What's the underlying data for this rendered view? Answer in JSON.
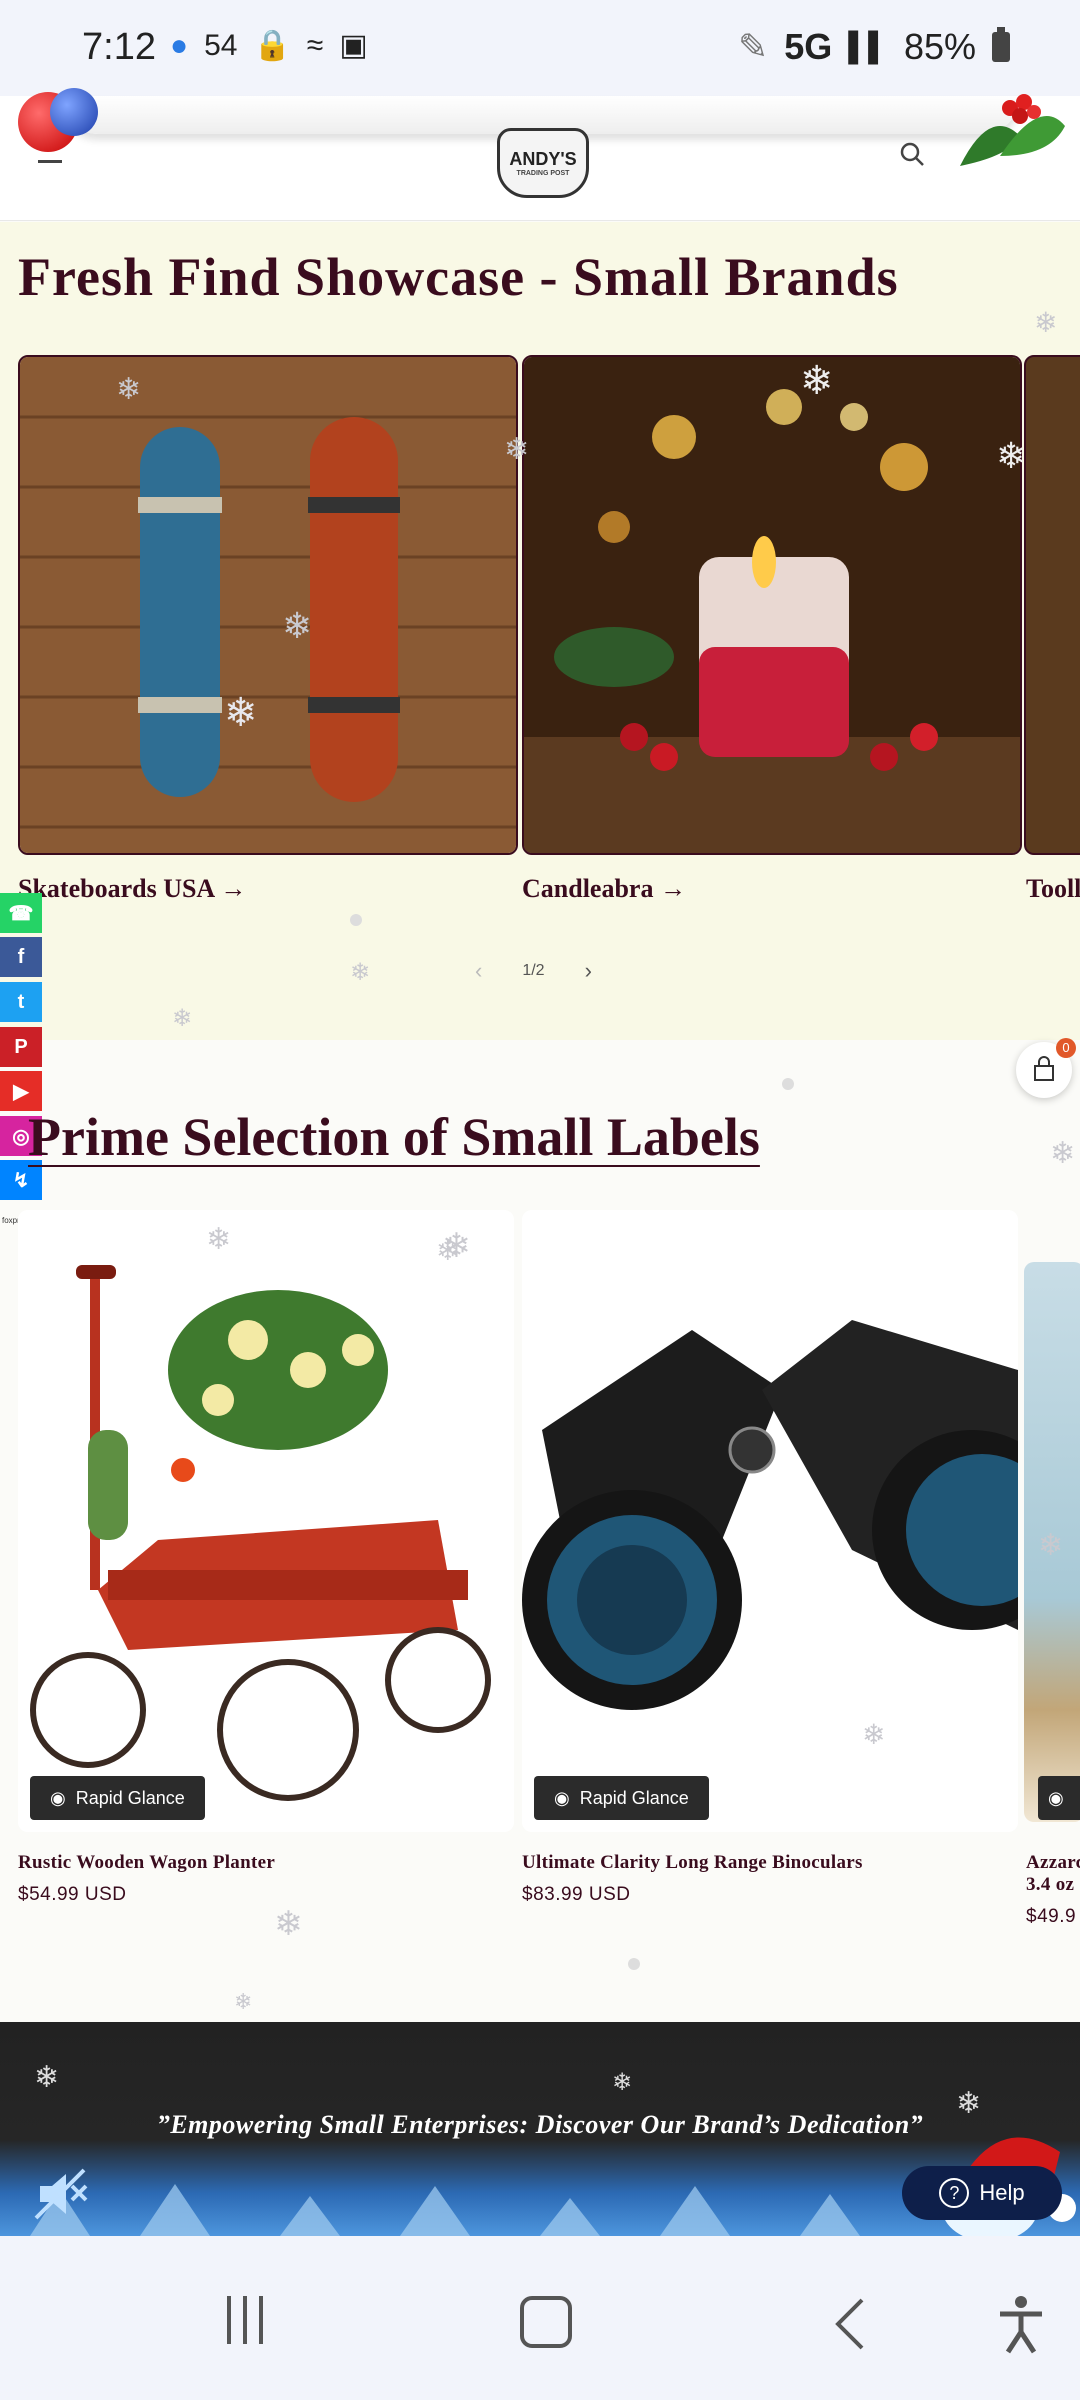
{
  "status_bar": {
    "time": "7:12",
    "mid_icons": "54",
    "network": "5G",
    "battery": "85%"
  },
  "header": {
    "logo_line1": "ANDY'S",
    "logo_line2": "TRADING POST"
  },
  "showcase": {
    "title": "Fresh Find Showcase - Small Brands",
    "cards": [
      {
        "label": "Skateboards USA →"
      },
      {
        "label": "Candleabra →"
      },
      {
        "label": "Tooll"
      }
    ],
    "pager": {
      "prev": "‹",
      "text": "1/2",
      "next": "›"
    }
  },
  "social": [
    {
      "name": "whatsapp",
      "glyph": "☎",
      "color": "#25d366"
    },
    {
      "name": "facebook",
      "glyph": "f",
      "color": "#3b5998"
    },
    {
      "name": "twitter",
      "glyph": "t",
      "color": "#1da1f2"
    },
    {
      "name": "pinterest",
      "glyph": "P",
      "color": "#cb2027"
    },
    {
      "name": "youtube",
      "glyph": "▶",
      "color": "#e52d27"
    },
    {
      "name": "instagram",
      "glyph": "◎",
      "color": "#d6249f"
    },
    {
      "name": "messenger",
      "glyph": "↯",
      "color": "#0084ff"
    }
  ],
  "cart": {
    "count": "0"
  },
  "prime": {
    "title": "Prime Selection of Small Labels",
    "tiny_label": "foxprime",
    "quick_label": "Rapid Glance",
    "products": [
      {
        "title": "Rustic Wooden Wagon Planter",
        "price": "$54.99 USD"
      },
      {
        "title": "Ultimate Clarity Long Range Binoculars",
        "price": "$83.99 USD"
      },
      {
        "title": "Azzarc",
        "title2": "3.4 oz",
        "price": "$49.9"
      }
    ]
  },
  "banner": {
    "text": "”Empowering Small Enterprises: Discover Our Brand’s Dedication”",
    "help": "Help"
  }
}
